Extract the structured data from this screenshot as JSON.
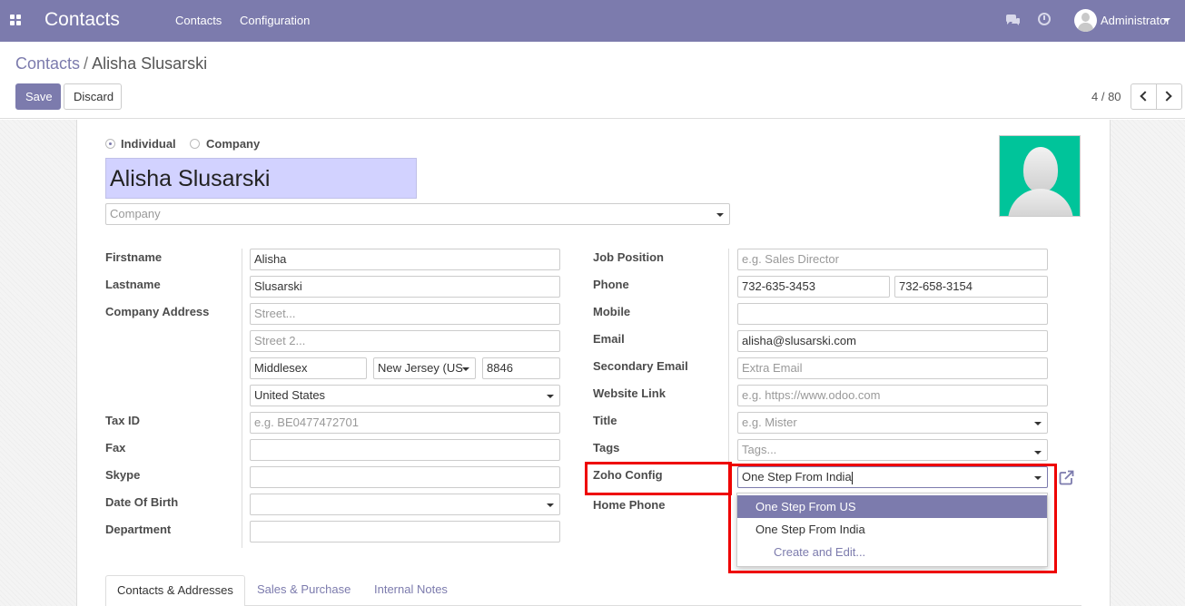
{
  "navbar": {
    "app_title": "Contacts",
    "menu": [
      "Contacts",
      "Configuration"
    ],
    "user": "Administrator"
  },
  "breadcrumb": {
    "parent": "Contacts",
    "separator": "/",
    "current": "Alisha Slusarski"
  },
  "buttons": {
    "save": "Save",
    "discard": "Discard"
  },
  "pager": {
    "value": "4 / 80"
  },
  "form": {
    "type_options": [
      "Individual",
      "Company"
    ],
    "type_selected": "Individual",
    "name": "Alisha Slusarski",
    "company_placeholder": "Company",
    "left": {
      "labels": {
        "firstname": "Firstname",
        "lastname": "Lastname",
        "company_address": "Company Address",
        "tax_id": "Tax ID",
        "fax": "Fax",
        "skype": "Skype",
        "date_of_birth": "Date Of Birth",
        "department": "Department"
      },
      "values": {
        "firstname": "Alisha",
        "lastname": "Slusarski",
        "street_placeholder": "Street...",
        "street2_placeholder": "Street 2...",
        "city": "Middlesex",
        "state": "New Jersey (US",
        "zip": "8846",
        "country": "United States",
        "tax_id_placeholder": "e.g. BE0477472701"
      }
    },
    "right": {
      "labels": {
        "job_position": "Job Position",
        "phone": "Phone",
        "mobile": "Mobile",
        "email": "Email",
        "secondary_email": "Secondary Email",
        "website_link": "Website Link",
        "title": "Title",
        "tags": "Tags",
        "zoho_config": "Zoho Config",
        "home_phone": "Home Phone"
      },
      "values": {
        "job_position_placeholder": "e.g. Sales Director",
        "phone": "732-635-3453",
        "phone2": "732-658-3154",
        "email": "alisha@slusarski.com",
        "secondary_email_placeholder": "Extra Email",
        "website_placeholder": "e.g. https://www.odoo.com",
        "title_placeholder": "e.g. Mister",
        "tags_placeholder": "Tags...",
        "zoho_config": "One Step From India"
      }
    },
    "zoho_dropdown": {
      "options": [
        "One Step From US",
        "One Step From India"
      ],
      "active_index": 0,
      "create": "Create and Edit..."
    },
    "tabs": [
      "Contacts & Addresses",
      "Sales & Purchase",
      "Internal Notes"
    ],
    "active_tab": 0
  },
  "colors": {
    "brand": "#7c7bad",
    "highlight": "#e00000",
    "photo_bg": "#00c49a"
  }
}
